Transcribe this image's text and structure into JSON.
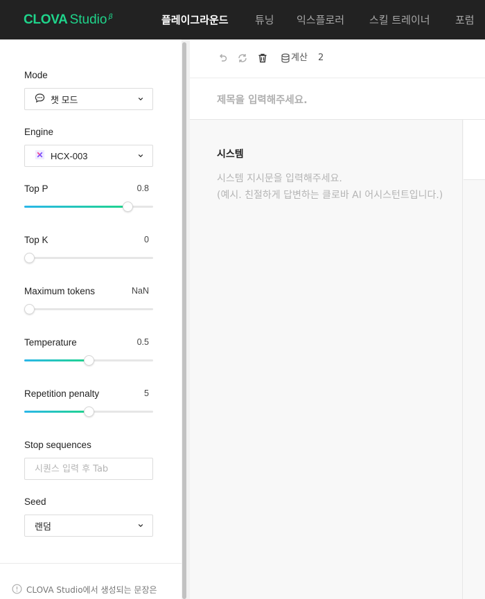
{
  "brand": {
    "name": "CLOVA",
    "name2": "Studio",
    "beta": "β"
  },
  "nav": [
    {
      "label": "플레이그라운드",
      "active": true
    },
    {
      "label": "튜닝",
      "active": false
    },
    {
      "label": "익스플로러",
      "active": false
    },
    {
      "label": "스킬 트레이너",
      "active": false
    },
    {
      "label": "포럼",
      "active": false
    }
  ],
  "params": {
    "mode": {
      "label": "Mode",
      "value": "챗 모드",
      "icon": "chat-bubble-icon"
    },
    "engine": {
      "label": "Engine",
      "value": "HCX-003",
      "icon": "engine-x-icon"
    },
    "top_p": {
      "label": "Top P",
      "value": "0.8",
      "fill": 0.8
    },
    "top_k": {
      "label": "Top K",
      "value": "0",
      "fill": 0.0
    },
    "max_tokens": {
      "label": "Maximum tokens",
      "value": "NaN",
      "fill": 0.0
    },
    "temperature": {
      "label": "Temperature",
      "value": "0.5",
      "fill": 0.5
    },
    "repetition_penalty": {
      "label": "Repetition penalty",
      "value": "5",
      "fill": 0.5
    },
    "stop_sequences": {
      "label": "Stop sequences",
      "placeholder": "시퀀스 입력 후 Tab"
    },
    "seed": {
      "label": "Seed",
      "value": "랜덤"
    }
  },
  "notice": "CLOVA Studio에서 생성되는 문장은",
  "toolbar": {
    "calc_label": "계산",
    "calc_count": "2"
  },
  "title_placeholder": "제목을 입력해주세요.",
  "system": {
    "title": "시스템",
    "placeholder_line1": "시스템 지시문을 입력해주세요.",
    "placeholder_line2": "(예시. 친절하게 답변하는 클로바 AI 어시스턴트입니다.)"
  },
  "colors": {
    "topbar": "#222222",
    "brand": "#1fd48b",
    "slider_start": "#2ab7e9",
    "slider_end": "#1fd48b"
  }
}
